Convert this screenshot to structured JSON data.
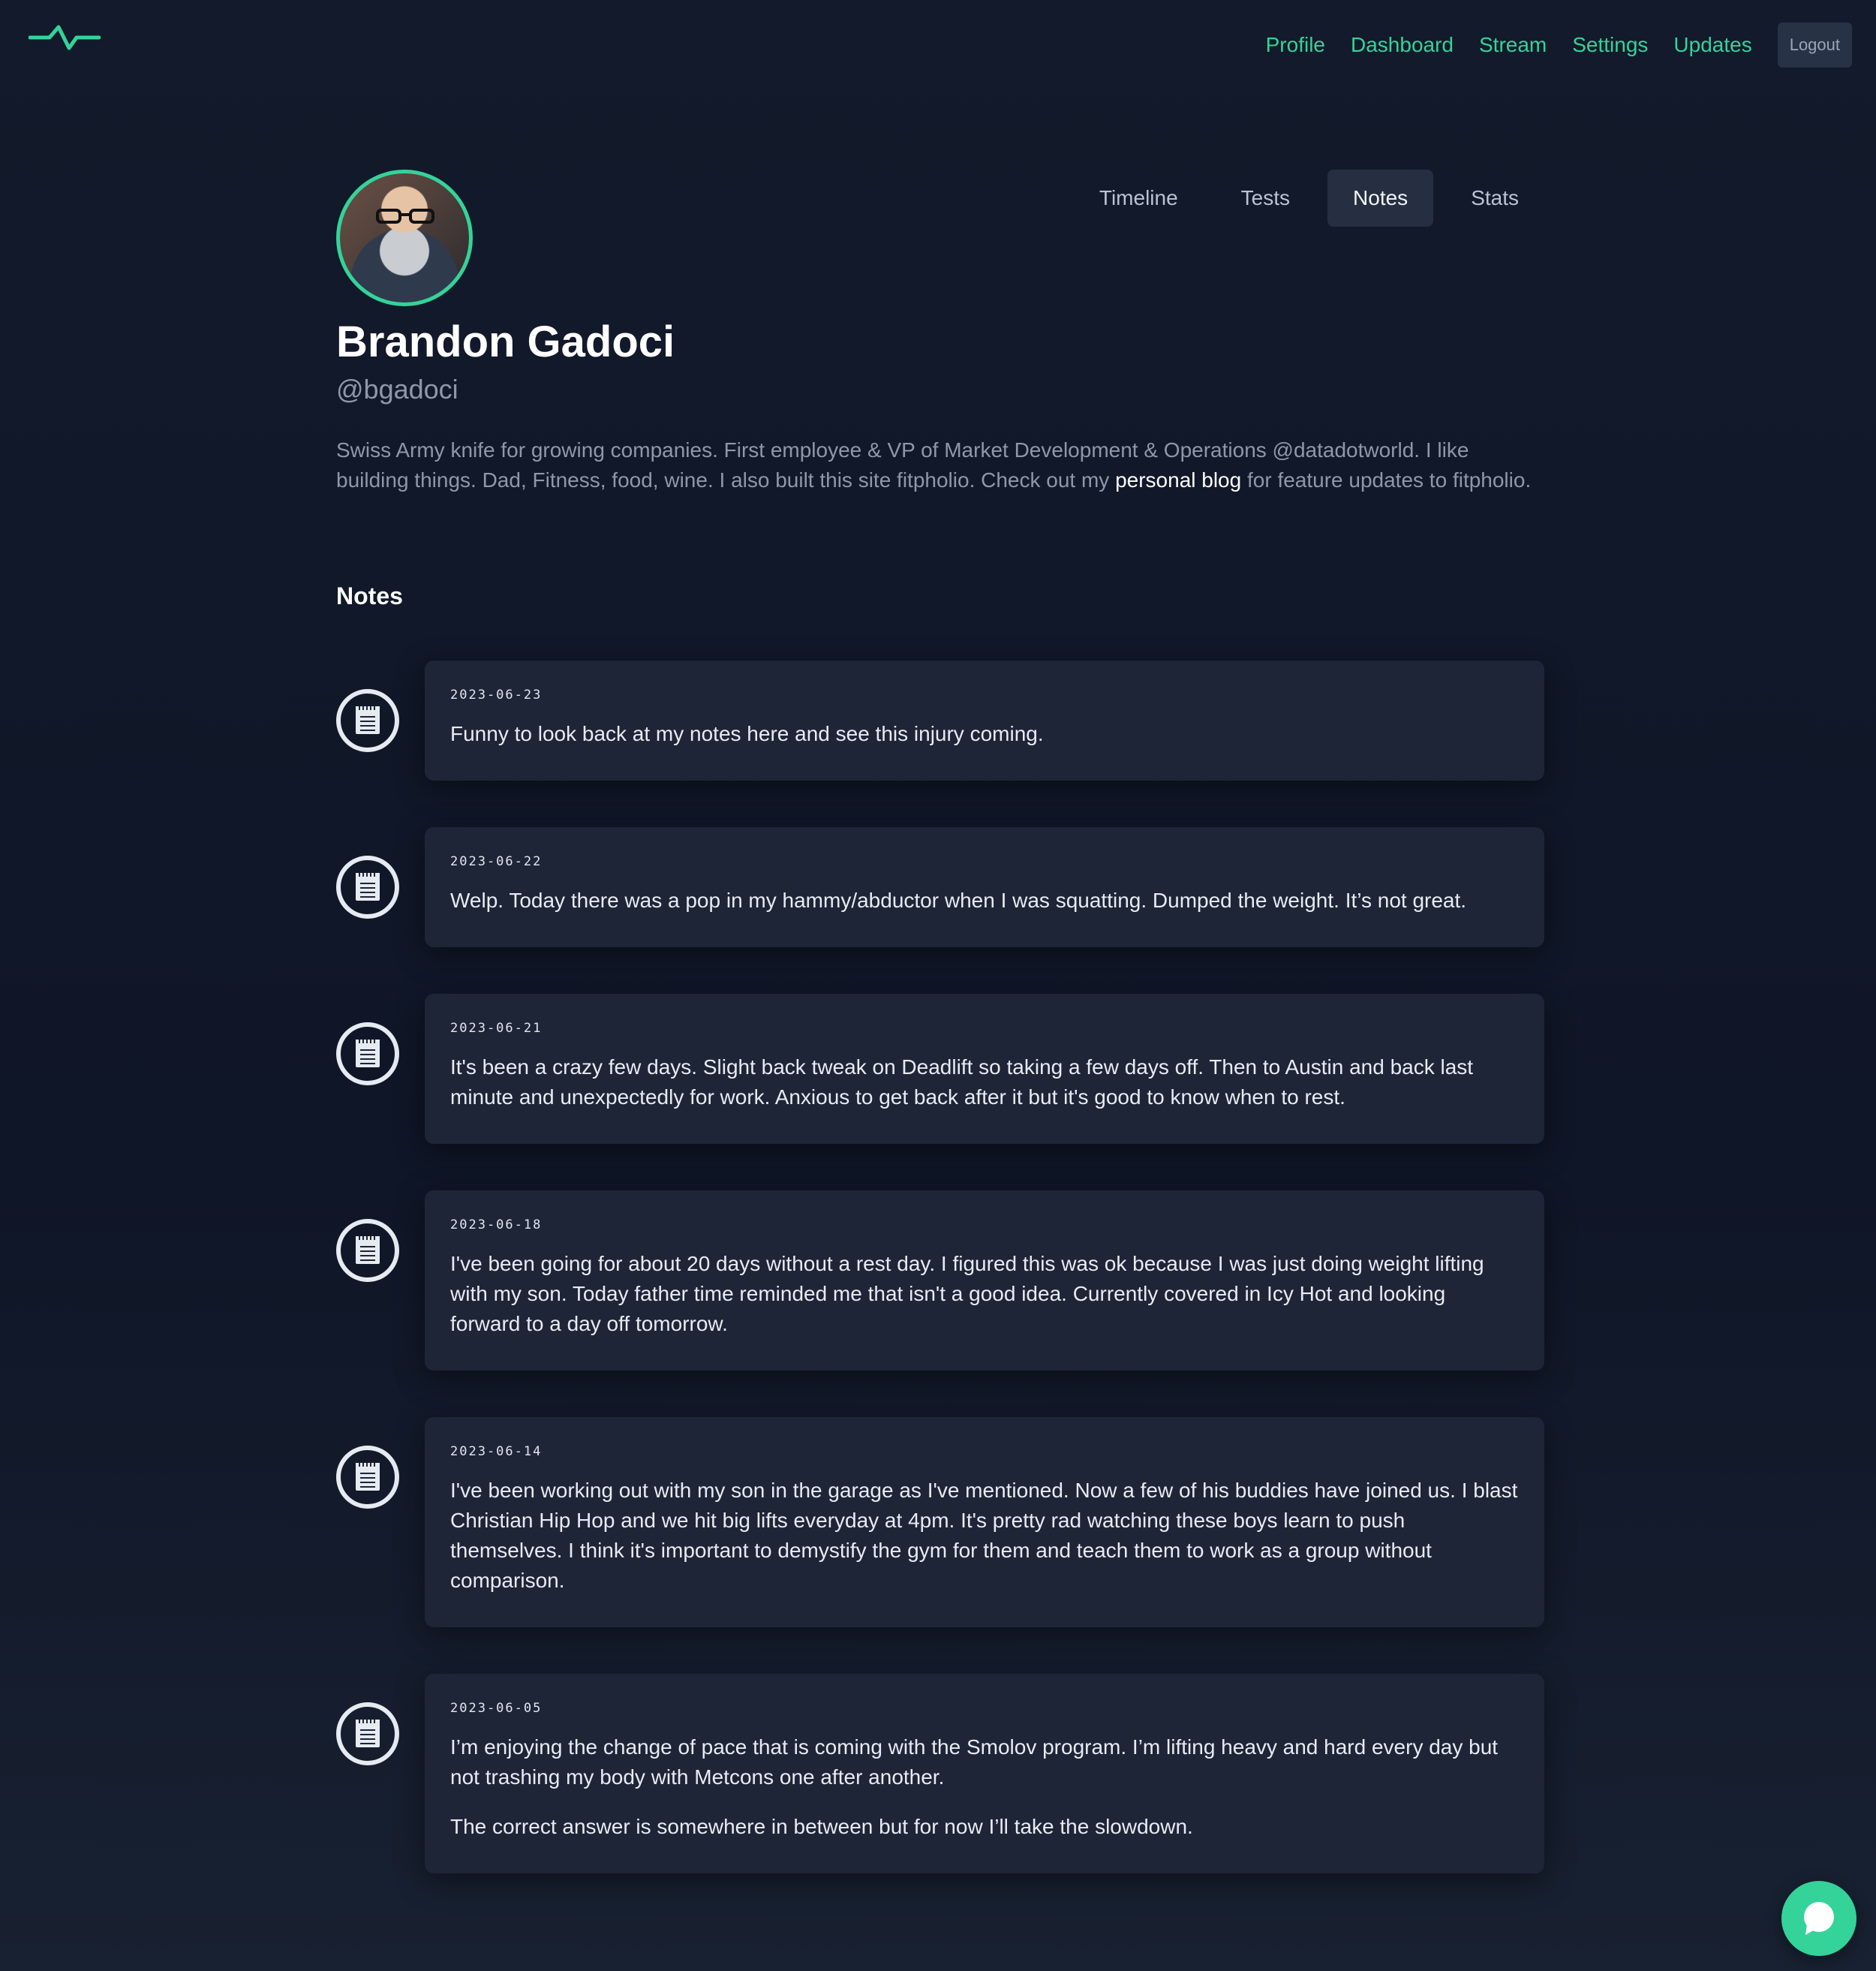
{
  "nav": {
    "logo_icon": "pulse-icon",
    "links": [
      "Profile",
      "Dashboard",
      "Stream",
      "Settings",
      "Updates"
    ],
    "logout_label": "Logout"
  },
  "tabs": {
    "items": [
      "Timeline",
      "Tests",
      "Notes",
      "Stats"
    ],
    "active": "Notes"
  },
  "profile": {
    "name": "Brandon Gadoci",
    "handle": "@bgadoci",
    "bio_before_link": "Swiss Army knife for growing companies. First employee & VP of Market Development & Operations @datadotworld. I like building things. Dad, Fitness, food, wine. I also built this site fitpholio. Check out my ",
    "bio_link": "personal blog",
    "bio_after_link": " for feature updates to fitpholio."
  },
  "notes_section": {
    "title": "Notes",
    "items": [
      {
        "date": "2023-06-23",
        "paragraphs": [
          "Funny to look back at my notes here and see this injury coming."
        ]
      },
      {
        "date": "2023-06-22",
        "paragraphs": [
          "Welp. Today there was a pop in my hammy/abductor when I was squatting. Dumped the weight. It’s not great."
        ]
      },
      {
        "date": "2023-06-21",
        "paragraphs": [
          "It's been a crazy few days. Slight back tweak on Deadlift so taking a few days off. Then to Austin and back last minute and unexpectedly for work. Anxious to get back after it but it's good to know when to rest."
        ]
      },
      {
        "date": "2023-06-18",
        "paragraphs": [
          "I've been going for about 20 days without a rest day. I figured this was ok because I was just doing weight lifting with my son. Today father time reminded me that isn't a good idea. Currently covered in Icy Hot and looking forward to a day off tomorrow."
        ]
      },
      {
        "date": "2023-06-14",
        "paragraphs": [
          "I've been working out with my son in the garage as I've mentioned. Now a few of his buddies have joined us. I blast Christian Hip Hop and we hit big lifts everyday at 4pm. It's pretty rad watching these boys learn to push themselves. I think it's important to demystify the gym for them and teach them to work as a group without comparison."
        ]
      },
      {
        "date": "2023-06-05",
        "paragraphs": [
          "I’m enjoying the change of pace that is coming with the Smolov program. I’m lifting heavy and hard every day but not trashing my body with Metcons one after another.",
          "The correct answer is somewhere in between but for now I’ll take the slowdown."
        ]
      }
    ]
  },
  "chat": {
    "icon": "chat-bubble-icon"
  },
  "colors": {
    "accent": "#34d399",
    "background": "#121a2b",
    "card": "#1d2537",
    "muted_text": "#8e98a8"
  }
}
